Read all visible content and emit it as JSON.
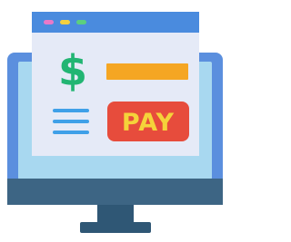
{
  "payment": {
    "currency_symbol": "$",
    "button_label": "PAY"
  },
  "icons": {
    "monitor": "monitor-icon",
    "browser_window": "browser-window-icon",
    "dollar": "dollar-icon",
    "menu_lines": "menu-lines-icon"
  },
  "colors": {
    "monitor_frame": "#5b8fde",
    "screen_inner": "#a8d8f0",
    "monitor_bottom_bar": "#3d6584",
    "stand": "#2f5775",
    "window_body": "#e5eaf7",
    "window_titlebar": "#4a8bde",
    "dot_pink": "#e879c8",
    "dot_yellow": "#f4d03f",
    "dot_green": "#5ccf7e",
    "dollar": "#22b573",
    "amount_bar": "#f5a623",
    "pay_button": "#e74c3c",
    "pay_text": "#f5d33a",
    "menu_lines": "#3fa0e8"
  }
}
